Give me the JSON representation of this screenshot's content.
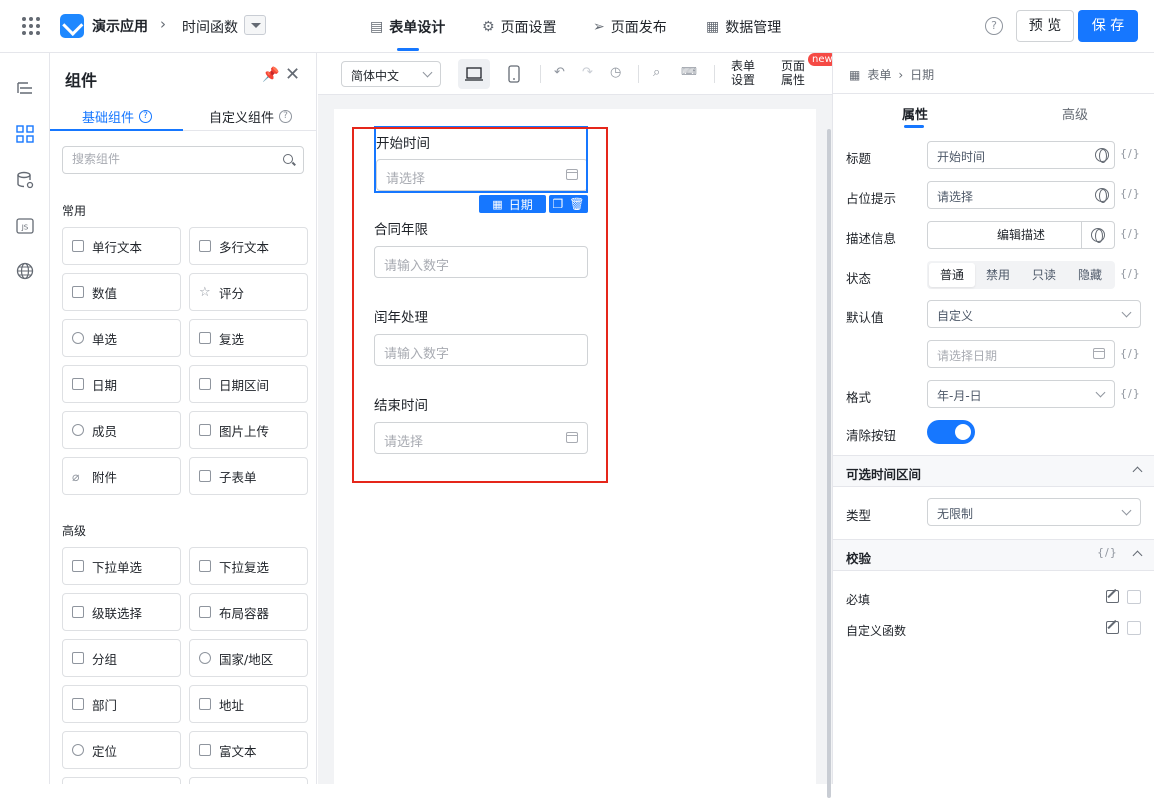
{
  "app": {
    "name": "演示应用",
    "page": "时间函数"
  },
  "top_tabs": [
    {
      "label": "表单设计",
      "icon": "doc-icon"
    },
    {
      "label": "页面设置",
      "icon": "gear-icon"
    },
    {
      "label": "页面发布",
      "icon": "send-icon"
    },
    {
      "label": "数据管理",
      "icon": "table-icon"
    }
  ],
  "actions": {
    "help": "?",
    "preview": "预 览",
    "save": "保 存"
  },
  "panel": {
    "title": "组件",
    "tabs": [
      "基础组件",
      "自定义组件"
    ],
    "search_placeholder": "搜索组件",
    "common_title": "常用",
    "common": [
      "单行文本",
      "多行文本",
      "数值",
      "评分",
      "单选",
      "复选",
      "日期",
      "日期区间",
      "成员",
      "图片上传",
      "附件",
      "子表单"
    ],
    "advanced_title": "高级",
    "advanced": [
      "下拉单选",
      "下拉复选",
      "级联选择",
      "布局容器",
      "分组",
      "国家/地区",
      "部门",
      "地址",
      "定位",
      "富文本"
    ]
  },
  "toolbar": {
    "language": "简体中文",
    "form_settings": [
      "表单",
      "设置"
    ],
    "page_props": [
      "页面",
      "属性"
    ],
    "new_badge": "new"
  },
  "form": {
    "fields": [
      {
        "label": "开始时间",
        "placeholder": "请选择"
      },
      {
        "label": "合同年限",
        "placeholder": "请输入数字"
      },
      {
        "label": "闰年处理",
        "placeholder": "请输入数字"
      },
      {
        "label": "结束时间",
        "placeholder": "请选择"
      }
    ],
    "selected_tag": "日期"
  },
  "props": {
    "breadcrumb": [
      "表单",
      "日期"
    ],
    "tabs": [
      "属性",
      "高级"
    ],
    "title_label": "标题",
    "title_value": "开始时间",
    "placeholder_label": "占位提示",
    "placeholder_value": "请选择",
    "desc_label": "描述信息",
    "desc_button": "编辑描述",
    "state_label": "状态",
    "states": [
      "普通",
      "禁用",
      "只读",
      "隐藏"
    ],
    "default_label": "默认值",
    "default_value": "自定义",
    "default_date_placeholder": "请选择日期",
    "format_label": "格式",
    "format_value": "年-月-日",
    "clear_label": "清除按钮",
    "clear_on": true,
    "range_section": "可选时间区间",
    "type_label": "类型",
    "type_value": "无限制",
    "validate_section": "校验",
    "required_label": "必填",
    "custom_func_label": "自定义函数",
    "fx": "{/}"
  }
}
